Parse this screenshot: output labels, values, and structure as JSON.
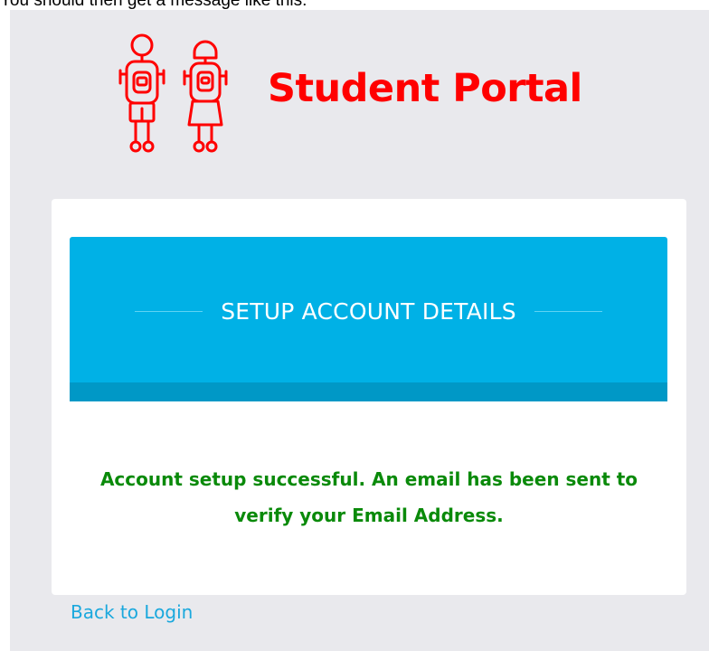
{
  "caption": "You should then get a message like this:",
  "header": {
    "logo_icon": "student-kids-icon",
    "title": "Student Portal",
    "brand_color": "#ff0000"
  },
  "card": {
    "banner_title": "SETUP ACCOUNT DETAILS",
    "banner_color": "#00b1e6",
    "message_line1": "Account setup successful. An email has been sent to",
    "message_line2": "verify your Email Address.",
    "message_color": "#0a8a0a"
  },
  "footer": {
    "back_link_label": "Back to Login",
    "link_color": "#1aa8dd"
  }
}
